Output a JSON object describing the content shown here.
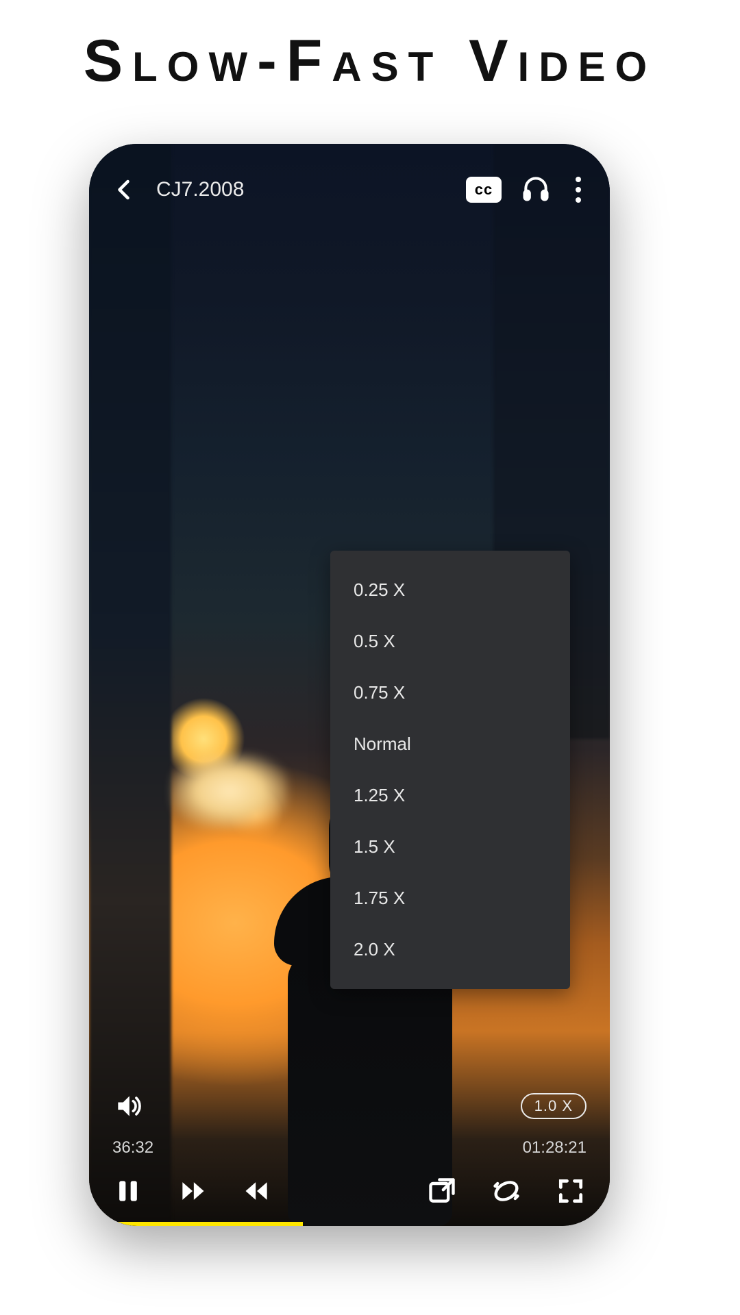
{
  "hero": {
    "title": "Slow-Fast Video"
  },
  "player": {
    "video_title": "CJ7.2008",
    "cc_label": "cc",
    "speed_pill": "1.0 X",
    "elapsed": "36:32",
    "duration": "01:28:21",
    "progress_percent": 41,
    "speed_options": [
      "0.25 X",
      "0.5 X",
      "0.75 X",
      "Normal",
      "1.25 X",
      "1.5 X",
      "1.75 X",
      "2.0 X"
    ]
  }
}
